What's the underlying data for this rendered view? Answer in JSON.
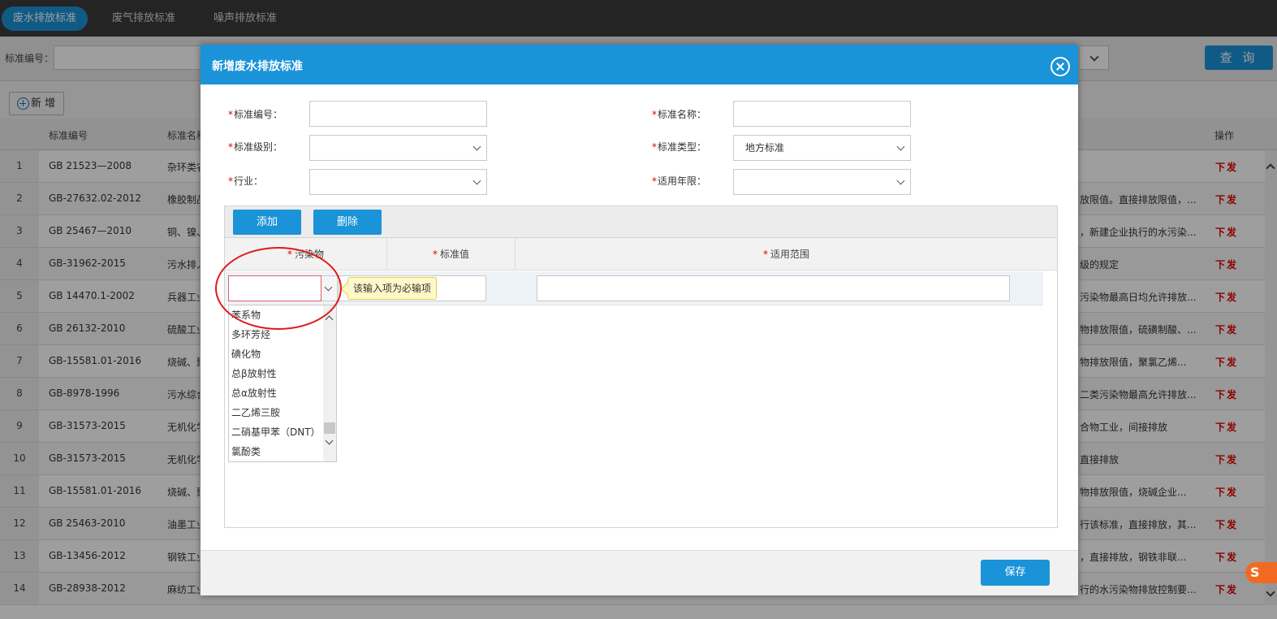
{
  "top_tabs": [
    {
      "label": "废水排放标准",
      "active": true
    },
    {
      "label": "废气排放标准",
      "active": false
    },
    {
      "label": "噪声排放标准",
      "active": false
    }
  ],
  "search": {
    "label": "标准编号：",
    "query_label": "查 询"
  },
  "toolbar": {
    "add_label": "新 增"
  },
  "grid": {
    "columns": [
      "标准编号",
      "标准名称",
      "操作"
    ],
    "rows": [
      {
        "idx": "1",
        "code": "GB 21523—2008",
        "name": "杂环类农",
        "desc": "",
        "op": "下发"
      },
      {
        "idx": "2",
        "code": "GB-27632.02-2012",
        "name": "橡胶制品",
        "desc": "放限值。直接排放限值，...",
        "op": "下发"
      },
      {
        "idx": "3",
        "code": "GB 25467—2010",
        "name": "铜、镍、",
        "desc": "，新建企业执行的水污染...",
        "op": "下发"
      },
      {
        "idx": "4",
        "code": "GB-31962-2015",
        "name": "污水排入",
        "desc": "级的规定",
        "op": "下发"
      },
      {
        "idx": "5",
        "code": "GB 14470.1-2002",
        "name": "兵器工业",
        "desc": "污染物最高日均允许排放...",
        "op": "下发"
      },
      {
        "idx": "6",
        "code": "GB 26132-2010",
        "name": "硫酸工业",
        "desc": "物排放限值，硫磺制酸、...",
        "op": "下发"
      },
      {
        "idx": "7",
        "code": "GB-15581.01-2016",
        "name": "烧碱、聚",
        "desc": "物排放限值，聚氯乙烯...",
        "op": "下发"
      },
      {
        "idx": "8",
        "code": "GB-8978-1996",
        "name": "污水综合",
        "desc": "二类污染物最高允许排放...",
        "op": "下发"
      },
      {
        "idx": "9",
        "code": "GB-31573-2015",
        "name": "无机化学",
        "desc": "合物工业，间接排放",
        "op": "下发"
      },
      {
        "idx": "10",
        "code": "GB-31573-2015",
        "name": "无机化学",
        "desc": "直接排放",
        "op": "下发"
      },
      {
        "idx": "11",
        "code": "GB-15581.01-2016",
        "name": "烧碱、聚",
        "desc": "物排放限值，烧碱企业...",
        "op": "下发"
      },
      {
        "idx": "12",
        "code": "GB 25463-2010",
        "name": "油墨工业",
        "desc": "行该标准，直接排放，其...",
        "op": "下发"
      },
      {
        "idx": "13",
        "code": "GB-13456-2012",
        "name": "钢铁工业",
        "desc": "，直接排放，钢铁非联...",
        "op": "下发"
      },
      {
        "idx": "14",
        "code": "GB-28938-2012",
        "name": "麻纺工业",
        "desc": "行的水污染物排放控制要...",
        "op": "下发"
      }
    ]
  },
  "modal": {
    "title": "新增废水排放标准",
    "fields": {
      "code_label": "标准编号：",
      "name_label": "标准名称：",
      "level_label": "标准级别：",
      "type_label": "标准类型：",
      "type_value": "地方标准",
      "industry_label": "行业：",
      "year_label": "适用年限："
    },
    "sub_buttons": {
      "add": "添加",
      "delete": "删除"
    },
    "sub_columns": {
      "pollutant": "污染物",
      "value": "标准值",
      "scope": "适用范围"
    },
    "tooltip": "该输入项为必输项",
    "pollutant_options": [
      "苯系物",
      "多环芳烃",
      "碘化物",
      "总β放射性",
      "总α放射性",
      "二乙烯三胺",
      "二硝基甲苯（DNT）",
      "氯酚类"
    ],
    "save_label": "保存"
  },
  "badge": "S"
}
